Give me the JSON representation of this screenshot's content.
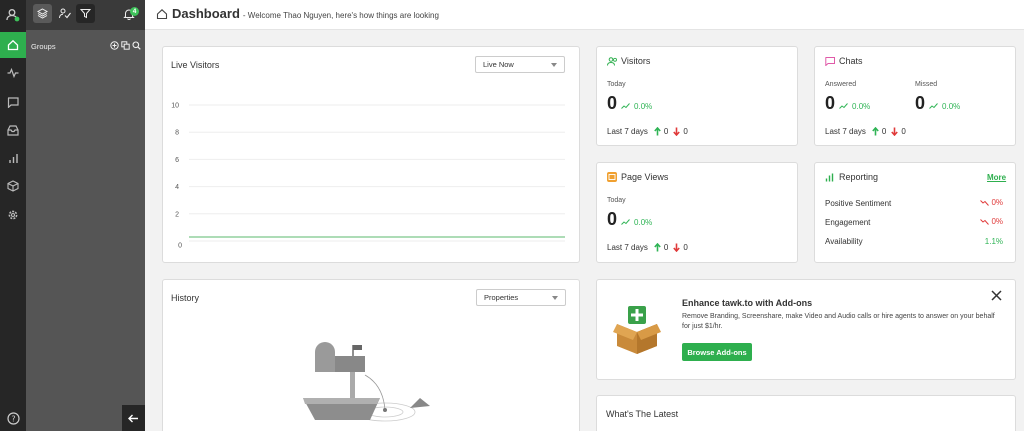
{
  "header": {
    "title": "Dashboard",
    "subtitle": "- Welcome Thao Nguyen, here's how things are looking"
  },
  "topbar": {
    "notification_count": "4"
  },
  "groups": {
    "label": "Groups"
  },
  "live_visitors": {
    "title": "Live Visitors",
    "select_value": "Live Now"
  },
  "chart_data": {
    "type": "line",
    "title": "Live Visitors",
    "xlabel": "",
    "ylabel": "",
    "ylim": [
      0,
      10
    ],
    "yticks": [
      "10",
      "8",
      "6",
      "4",
      "2",
      "0"
    ],
    "series": [
      {
        "values": [
          0,
          0
        ]
      }
    ],
    "grid": true,
    "line_color": "#7cc88a"
  },
  "history": {
    "title": "History",
    "select_value": "Properties"
  },
  "visitors": {
    "title": "Visitors",
    "today_label": "Today",
    "value": "0",
    "change": "0.0%",
    "last7_label": "Last 7 days",
    "up": "0",
    "down": "0"
  },
  "chats": {
    "title": "Chats",
    "answered_label": "Answered",
    "answered_value": "0",
    "answered_change": "0.0%",
    "missed_label": "Missed",
    "missed_value": "0",
    "missed_change": "0.0%",
    "last7_label": "Last 7 days",
    "up": "0",
    "down": "0"
  },
  "page_views": {
    "title": "Page Views",
    "today_label": "Today",
    "value": "0",
    "change": "0.0%",
    "last7_label": "Last 7 days",
    "up": "0",
    "down": "0"
  },
  "reporting": {
    "title": "Reporting",
    "more_label": "More",
    "rows": [
      {
        "label": "Positive Sentiment",
        "value": "0%"
      },
      {
        "label": "Engagement",
        "value": "0%"
      },
      {
        "label": "Availability",
        "value": "1.1%"
      }
    ]
  },
  "addons": {
    "title": "Enhance tawk.to with Add-ons",
    "desc_line1": "Remove Branding, Screenshare, make Video and Audio calls or hire agents to answer on your behalf",
    "desc_line2": "for just $1/hr.",
    "button_label": "Browse Add-ons"
  },
  "latest": {
    "title": "What's The Latest"
  },
  "colors": {
    "accent": "#2eaf4e",
    "up": "#2fb455",
    "down": "#e03a3a",
    "rail": "#262626",
    "panel": "#555555"
  }
}
